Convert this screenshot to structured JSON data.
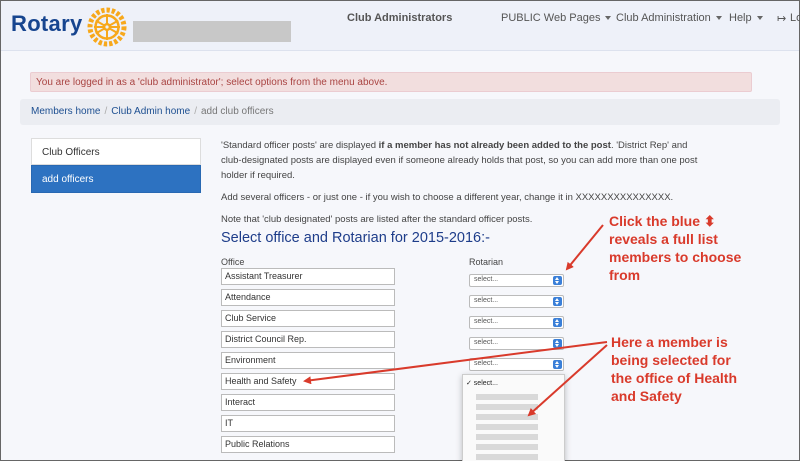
{
  "brand": {
    "name": "Rotary",
    "accent": "#17458f",
    "wheel_color": "#f7a81b"
  },
  "nav": {
    "title": "Club Administrators",
    "items": [
      {
        "label": "PUBLIC Web Pages"
      },
      {
        "label": "Club Administration"
      },
      {
        "label": "Help"
      }
    ],
    "logout_label": "Lo"
  },
  "alert": {
    "text": "You are logged in as a 'club administrator'; select options from the menu above."
  },
  "breadcrumb": {
    "items": [
      "Members home",
      "Club Admin home",
      "add club officers"
    ]
  },
  "sidebar": {
    "items": [
      {
        "label": "Club Officers"
      },
      {
        "label": "add officers"
      }
    ]
  },
  "content": {
    "para1_pre": "'Standard officer posts' are displayed ",
    "para1_bold": "if a member has not already been added to the post",
    "para1_post": ". 'District Rep' and club-designated posts are displayed even if someone already holds that post, so you can add more than one post holder if required.",
    "para2": "Add several officers - or just one - if you wish to choose a different year, change it in XXXXXXXXXXXXXXX.",
    "para3": "Note that 'club designated' posts are listed after the standard officer posts."
  },
  "form": {
    "heading": "Select office and Rotarian for 2015-2016:-",
    "col_office": "Office",
    "col_rotarian": "Rotarian",
    "offices": [
      "Assistant Treasurer",
      "Attendance",
      "Club Service",
      "District Council Rep.",
      "Environment",
      "Health and Safety",
      "Interact",
      "IT",
      "Public Relations"
    ],
    "select_placeholder": "select...",
    "dropdown_selected": "✓ select..."
  },
  "annotations": {
    "note1": [
      "Click the blue ⬍",
      "reveals a full list",
      "members to choose",
      "from"
    ],
    "note2": [
      "Here a member is",
      "being selected for",
      "the office of Health",
      "and Safety"
    ],
    "color": "#d93a2b"
  }
}
